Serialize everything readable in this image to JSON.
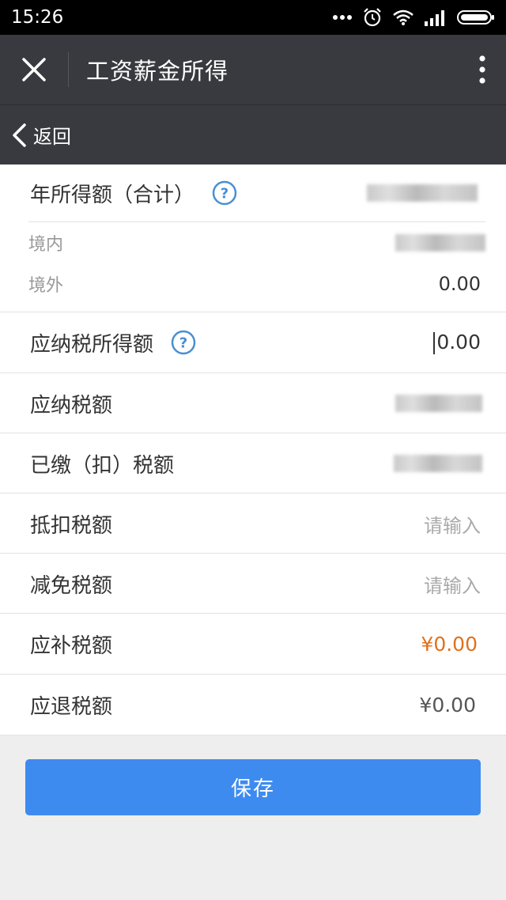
{
  "status_bar": {
    "time": "15:26"
  },
  "header": {
    "title": "工资薪金所得",
    "close_icon": "close-icon",
    "more_icon": "more-vertical-icon"
  },
  "subheader": {
    "back_label": "返回",
    "back_icon": "chevron-left-icon"
  },
  "form": {
    "annual_income": {
      "label": "年所得额（合计）",
      "value_obscured": true
    },
    "domestic": {
      "label": "境内",
      "value_obscured": true
    },
    "foreign": {
      "label": "境外",
      "value": "0.00"
    },
    "taxable_income": {
      "label": "应纳税所得额",
      "value": "0.00"
    },
    "tax_payable": {
      "label": "应纳税额",
      "value_obscured": true
    },
    "tax_paid": {
      "label": "已缴（扣）税额",
      "value_obscured": true
    },
    "tax_credit": {
      "label": "抵扣税额",
      "placeholder": "请输入"
    },
    "tax_reduction": {
      "label": "减免税额",
      "placeholder": "请输入"
    },
    "tax_due": {
      "label": "应补税额",
      "value": "¥0.00"
    },
    "tax_refund": {
      "label": "应退税额",
      "value": "¥0.00"
    }
  },
  "save_button": {
    "label": "保存"
  },
  "colors": {
    "header_bg": "#393a3f",
    "accent_blue": "#3e8bf0",
    "orange": "#e0711b",
    "help_icon": "#4a8fd4"
  }
}
